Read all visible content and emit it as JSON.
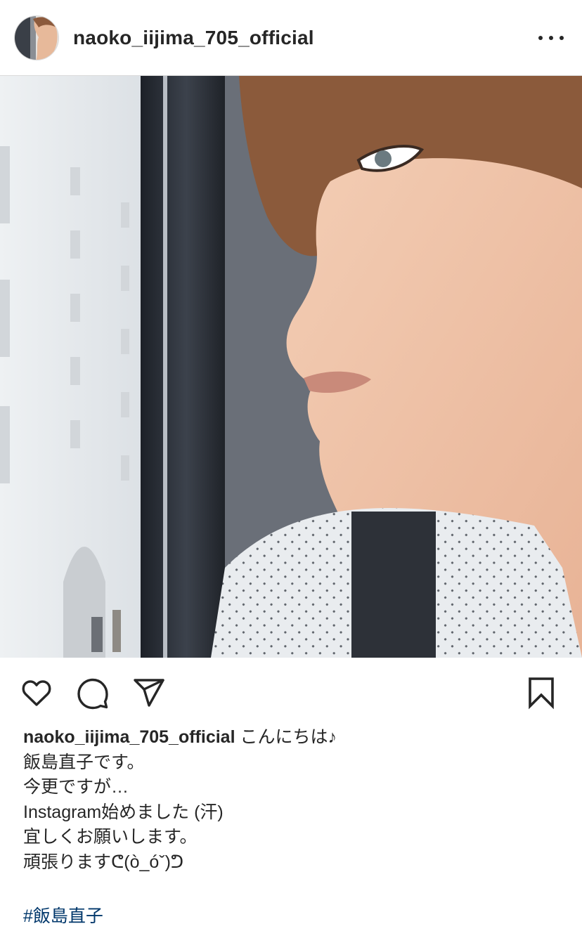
{
  "header": {
    "username": "naoko_iijima_705_official",
    "more_icon": "more-horizontal-icon"
  },
  "post": {
    "image_icon": "photo",
    "actions": {
      "like_icon": "heart-outline-icon",
      "comment_icon": "comment-bubble-icon",
      "share_icon": "send-paper-plane-icon",
      "save_icon": "bookmark-outline-icon"
    },
    "caption": {
      "username": "naoko_iijima_705_official",
      "first_line": "こんにちは♪",
      "lines": [
        "飯島直子です。",
        "今更ですが…",
        "Instagram始めました (汗)",
        "宜しくお願いします。",
        "頑張りますᕦ(ò_óˇ)ᕤ"
      ]
    },
    "hashtag": "#飯島直子"
  },
  "colors": {
    "text": "#262626",
    "hashtag": "#00376b",
    "divider": "#dbdbdb"
  }
}
